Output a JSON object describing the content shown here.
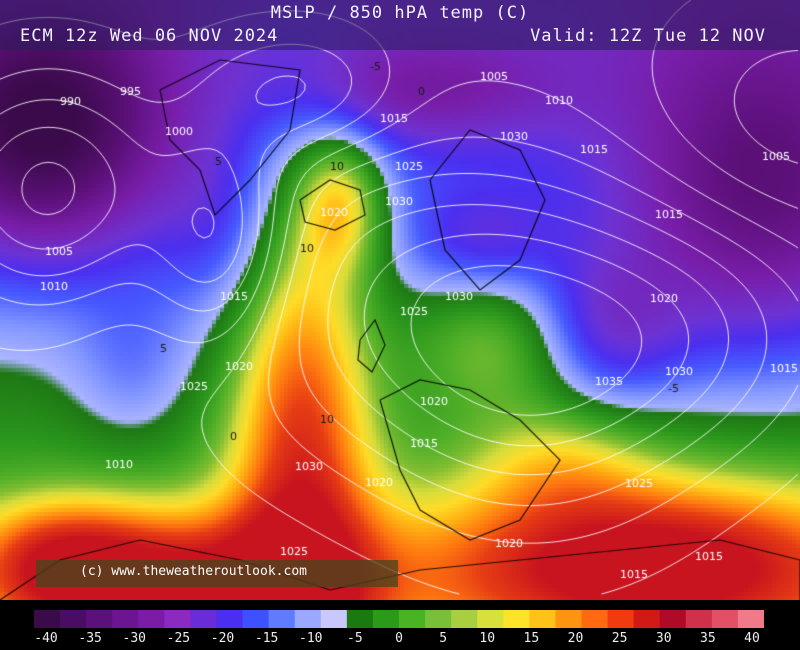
{
  "header": {
    "title": "MSLP / 850 hPA temp (C)",
    "run": "ECM 12z Wed 06 NOV 2024",
    "valid": "Valid: 12Z Tue 12 NOV"
  },
  "credit": "(c) www.theweatheroutlook.com",
  "scale": {
    "ticks": [
      "-40",
      "-35",
      "-30",
      "-25",
      "-20",
      "-15",
      "-10",
      "-5",
      "0",
      "5",
      "10",
      "15",
      "20",
      "25",
      "30",
      "35",
      "40"
    ],
    "colors": [
      "#3a0a4a",
      "#4a0d63",
      "#5c1079",
      "#6b1690",
      "#7a1ca6",
      "#8a2ac0",
      "#6a2bd8",
      "#4b2ff0",
      "#3d52ff",
      "#5f7bff",
      "#9aa8ff",
      "#c8c8ff",
      "#1a7a10",
      "#2a9a18",
      "#49b324",
      "#78c03a",
      "#a8cf40",
      "#d8e03a",
      "#ffe22a",
      "#ffc21a",
      "#ff9410",
      "#ff6a10",
      "#f03a10",
      "#d01a18",
      "#b00a28",
      "#d0304a",
      "#e35066",
      "#f07a8a"
    ]
  },
  "map": {
    "isobar_labels": [
      "990",
      "995",
      "1000",
      "1005",
      "1010",
      "1015",
      "1020",
      "1025",
      "1030",
      "1035"
    ],
    "temp_labels": [
      "-5",
      "0",
      "5",
      "10"
    ]
  },
  "colors": {
    "header_bg": "#281e5a",
    "isobar": "#ffffff",
    "coast": "#000000"
  }
}
